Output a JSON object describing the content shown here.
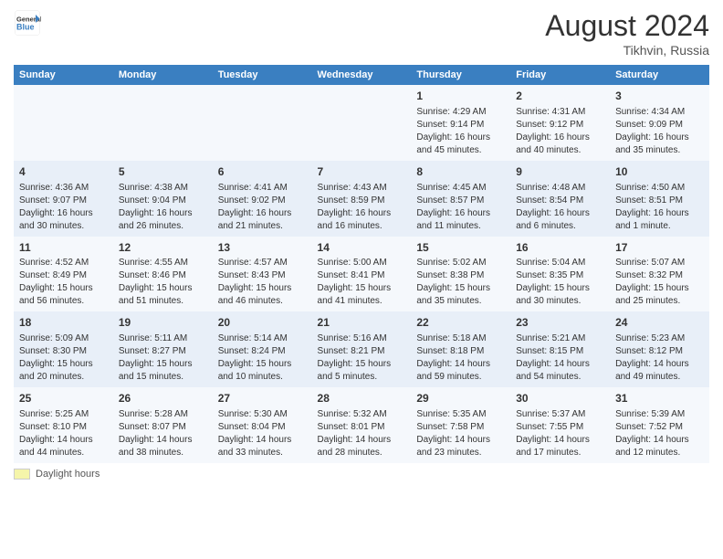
{
  "header": {
    "logo_line1": "General",
    "logo_line2": "Blue",
    "main_title": "August 2024",
    "subtitle": "Tikhvin, Russia"
  },
  "columns": [
    "Sunday",
    "Monday",
    "Tuesday",
    "Wednesday",
    "Thursday",
    "Friday",
    "Saturday"
  ],
  "legend_label": "Daylight hours",
  "weeks": [
    [
      {
        "num": "",
        "info": ""
      },
      {
        "num": "",
        "info": ""
      },
      {
        "num": "",
        "info": ""
      },
      {
        "num": "",
        "info": ""
      },
      {
        "num": "1",
        "info": "Sunrise: 4:29 AM\nSunset: 9:14 PM\nDaylight: 16 hours\nand 45 minutes."
      },
      {
        "num": "2",
        "info": "Sunrise: 4:31 AM\nSunset: 9:12 PM\nDaylight: 16 hours\nand 40 minutes."
      },
      {
        "num": "3",
        "info": "Sunrise: 4:34 AM\nSunset: 9:09 PM\nDaylight: 16 hours\nand 35 minutes."
      }
    ],
    [
      {
        "num": "4",
        "info": "Sunrise: 4:36 AM\nSunset: 9:07 PM\nDaylight: 16 hours\nand 30 minutes."
      },
      {
        "num": "5",
        "info": "Sunrise: 4:38 AM\nSunset: 9:04 PM\nDaylight: 16 hours\nand 26 minutes."
      },
      {
        "num": "6",
        "info": "Sunrise: 4:41 AM\nSunset: 9:02 PM\nDaylight: 16 hours\nand 21 minutes."
      },
      {
        "num": "7",
        "info": "Sunrise: 4:43 AM\nSunset: 8:59 PM\nDaylight: 16 hours\nand 16 minutes."
      },
      {
        "num": "8",
        "info": "Sunrise: 4:45 AM\nSunset: 8:57 PM\nDaylight: 16 hours\nand 11 minutes."
      },
      {
        "num": "9",
        "info": "Sunrise: 4:48 AM\nSunset: 8:54 PM\nDaylight: 16 hours\nand 6 minutes."
      },
      {
        "num": "10",
        "info": "Sunrise: 4:50 AM\nSunset: 8:51 PM\nDaylight: 16 hours\nand 1 minute."
      }
    ],
    [
      {
        "num": "11",
        "info": "Sunrise: 4:52 AM\nSunset: 8:49 PM\nDaylight: 15 hours\nand 56 minutes."
      },
      {
        "num": "12",
        "info": "Sunrise: 4:55 AM\nSunset: 8:46 PM\nDaylight: 15 hours\nand 51 minutes."
      },
      {
        "num": "13",
        "info": "Sunrise: 4:57 AM\nSunset: 8:43 PM\nDaylight: 15 hours\nand 46 minutes."
      },
      {
        "num": "14",
        "info": "Sunrise: 5:00 AM\nSunset: 8:41 PM\nDaylight: 15 hours\nand 41 minutes."
      },
      {
        "num": "15",
        "info": "Sunrise: 5:02 AM\nSunset: 8:38 PM\nDaylight: 15 hours\nand 35 minutes."
      },
      {
        "num": "16",
        "info": "Sunrise: 5:04 AM\nSunset: 8:35 PM\nDaylight: 15 hours\nand 30 minutes."
      },
      {
        "num": "17",
        "info": "Sunrise: 5:07 AM\nSunset: 8:32 PM\nDaylight: 15 hours\nand 25 minutes."
      }
    ],
    [
      {
        "num": "18",
        "info": "Sunrise: 5:09 AM\nSunset: 8:30 PM\nDaylight: 15 hours\nand 20 minutes."
      },
      {
        "num": "19",
        "info": "Sunrise: 5:11 AM\nSunset: 8:27 PM\nDaylight: 15 hours\nand 15 minutes."
      },
      {
        "num": "20",
        "info": "Sunrise: 5:14 AM\nSunset: 8:24 PM\nDaylight: 15 hours\nand 10 minutes."
      },
      {
        "num": "21",
        "info": "Sunrise: 5:16 AM\nSunset: 8:21 PM\nDaylight: 15 hours\nand 5 minutes."
      },
      {
        "num": "22",
        "info": "Sunrise: 5:18 AM\nSunset: 8:18 PM\nDaylight: 14 hours\nand 59 minutes."
      },
      {
        "num": "23",
        "info": "Sunrise: 5:21 AM\nSunset: 8:15 PM\nDaylight: 14 hours\nand 54 minutes."
      },
      {
        "num": "24",
        "info": "Sunrise: 5:23 AM\nSunset: 8:12 PM\nDaylight: 14 hours\nand 49 minutes."
      }
    ],
    [
      {
        "num": "25",
        "info": "Sunrise: 5:25 AM\nSunset: 8:10 PM\nDaylight: 14 hours\nand 44 minutes."
      },
      {
        "num": "26",
        "info": "Sunrise: 5:28 AM\nSunset: 8:07 PM\nDaylight: 14 hours\nand 38 minutes."
      },
      {
        "num": "27",
        "info": "Sunrise: 5:30 AM\nSunset: 8:04 PM\nDaylight: 14 hours\nand 33 minutes."
      },
      {
        "num": "28",
        "info": "Sunrise: 5:32 AM\nSunset: 8:01 PM\nDaylight: 14 hours\nand 28 minutes."
      },
      {
        "num": "29",
        "info": "Sunrise: 5:35 AM\nSunset: 7:58 PM\nDaylight: 14 hours\nand 23 minutes."
      },
      {
        "num": "30",
        "info": "Sunrise: 5:37 AM\nSunset: 7:55 PM\nDaylight: 14 hours\nand 17 minutes."
      },
      {
        "num": "31",
        "info": "Sunrise: 5:39 AM\nSunset: 7:52 PM\nDaylight: 14 hours\nand 12 minutes."
      }
    ]
  ]
}
